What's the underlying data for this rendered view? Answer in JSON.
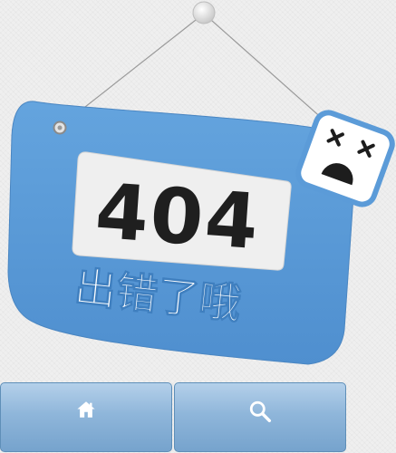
{
  "error_sign": {
    "code": "404",
    "message": "出错了哦"
  },
  "nav": {
    "home_icon": "home-icon",
    "search_icon": "search-icon"
  },
  "colors": {
    "sign_blue": "#5b9bd8",
    "sign_window": "#efefef",
    "badge_face": "#1d1d1d",
    "button_gradient_top": "#b4d0ea",
    "button_gradient_bottom": "#76a3cd"
  }
}
